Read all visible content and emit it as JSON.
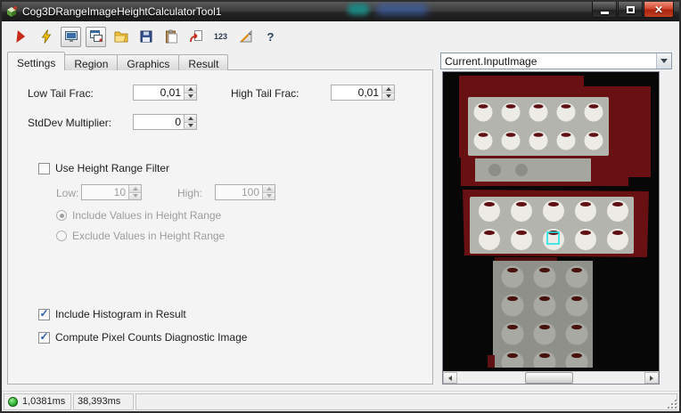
{
  "window": {
    "title": "Cog3DRangeImageHeightCalculatorTool1"
  },
  "toolbar": {
    "buttons": [
      {
        "name": "run-tool"
      },
      {
        "name": "auto-run-electric"
      },
      {
        "name": "show-image-display"
      },
      {
        "name": "float-image-display"
      },
      {
        "name": "open-file"
      },
      {
        "name": "save-file"
      },
      {
        "name": "paste"
      },
      {
        "name": "import-tool"
      },
      {
        "name": "pixel-grid-values",
        "text": "123"
      },
      {
        "name": "calibration"
      },
      {
        "name": "help",
        "text": "?"
      }
    ]
  },
  "tabs": {
    "items": [
      {
        "label": "Settings",
        "active": true
      },
      {
        "label": "Region",
        "active": false
      },
      {
        "label": "Graphics",
        "active": false
      },
      {
        "label": "Result",
        "active": false
      }
    ]
  },
  "settings": {
    "low_tail_frac": {
      "label": "Low Tail Frac:",
      "value": "0,01"
    },
    "high_tail_frac": {
      "label": "High Tail Frac:",
      "value": "0,01"
    },
    "stddev_multiplier": {
      "label": "StdDev Multiplier:",
      "value": "0"
    },
    "height_range_filter": {
      "label": "Use Height Range Filter",
      "checked": false,
      "low": {
        "label": "Low:",
        "value": "10"
      },
      "high": {
        "label": "High:",
        "value": "100"
      },
      "include_radio": {
        "label": "Include Values in Height Range",
        "selected": true
      },
      "exclude_radio": {
        "label": "Exclude Values in Height Range",
        "selected": false
      }
    },
    "include_histogram": {
      "label": "Include Histogram in Result",
      "checked": true
    },
    "compute_pixel_counts": {
      "label": "Compute Pixel Counts Diagnostic Image",
      "checked": true
    }
  },
  "image_panel": {
    "selected_image": "Current.InputImage",
    "colors": {
      "background": "#070707",
      "region_maroon": "#691013",
      "tray_gray": "#b4b4ae",
      "disc_white": "#edebe6",
      "selection_cyan": "#1ce6e6"
    }
  },
  "status_bar": {
    "run_time": "1,0381ms",
    "total_time": "38,393ms",
    "status_color": "#2eb22e"
  }
}
